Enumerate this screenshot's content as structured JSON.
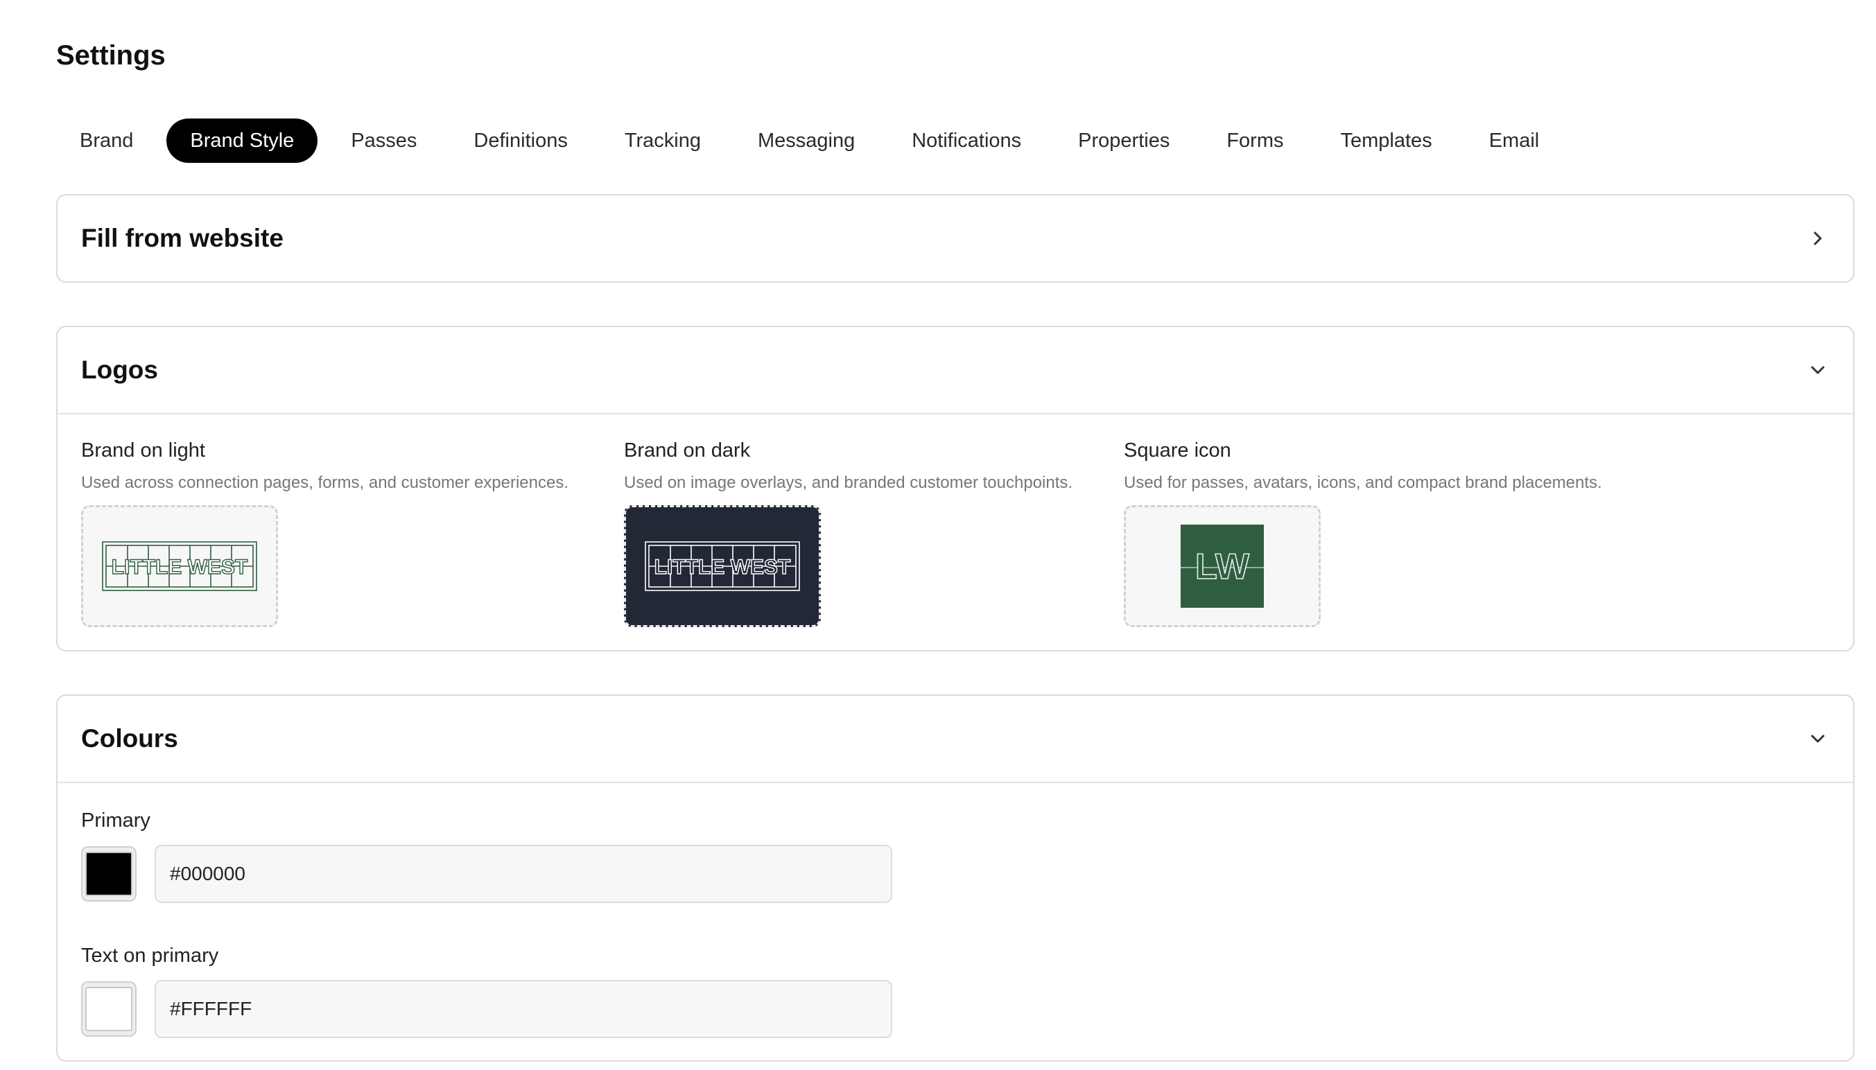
{
  "page": {
    "title": "Settings"
  },
  "tabs": [
    {
      "label": "Brand",
      "active": false
    },
    {
      "label": "Brand Style",
      "active": true
    },
    {
      "label": "Passes",
      "active": false
    },
    {
      "label": "Definitions",
      "active": false
    },
    {
      "label": "Tracking",
      "active": false
    },
    {
      "label": "Messaging",
      "active": false
    },
    {
      "label": "Notifications",
      "active": false
    },
    {
      "label": "Properties",
      "active": false
    },
    {
      "label": "Forms",
      "active": false
    },
    {
      "label": "Templates",
      "active": false
    },
    {
      "label": "Email",
      "active": false
    }
  ],
  "fill_from_website": {
    "title": "Fill from website",
    "icon": "chevron-right-icon"
  },
  "logos": {
    "title": "Logos",
    "icon": "chevron-down-icon",
    "items": [
      {
        "label": "Brand on light",
        "description": "Used across connection pages, forms, and customer experiences.",
        "logo_text": "LITTLE WEST"
      },
      {
        "label": "Brand on dark",
        "description": "Used on image overlays, and branded customer touchpoints.",
        "logo_text": "LITTLE WEST"
      },
      {
        "label": "Square icon",
        "description": "Used for passes, avatars, icons, and compact brand placements.",
        "logo_text": "LW"
      }
    ]
  },
  "colours": {
    "title": "Colours",
    "icon": "chevron-down-icon",
    "fields": [
      {
        "label": "Primary",
        "value": "#000000",
        "swatch": "#000000"
      },
      {
        "label": "Text on primary",
        "value": "#FFFFFF",
        "swatch": "#FFFFFF"
      }
    ]
  },
  "colors": {
    "accent": "#000000",
    "logo_green": "#2f5d40",
    "logo_dark_bg": "#232837",
    "border": "#dadada"
  }
}
